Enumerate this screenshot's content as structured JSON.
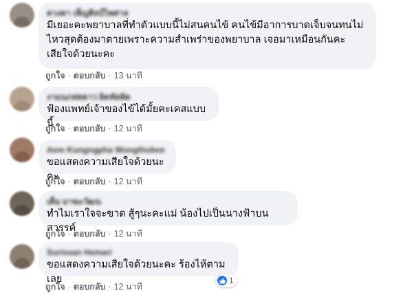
{
  "colors": {
    "bubble_bg": "#f0f2f5",
    "meta_text": "#65676b",
    "like_blue": "#1877f2"
  },
  "comments": [
    {
      "author": "ดวงตา เพ็ญศิลป์ไพศาล",
      "text": "มีเยอะคะพยาบาลที่ทำตัวแบบนี้ไม่สนคนไข้ คนไข้มีอาการบาดเจ็บจนทนไม่ไหวสุดต้องมาตายเพราะความสำเพร่าของพยาบาล เจอมาเหมือนกันคะ เสียใจด้วยนะคะ",
      "like": "ถูกใจ",
      "reply": "ตอบกลับ",
      "time": "13 นาที",
      "avatar_color": "#9a8f86"
    },
    {
      "author": "งามนภสตดาว ผิดหัดฝัด",
      "text": "ฟ้องแพทย์เจ้าของไข้ได้มั้ยคะเคสแบบนี้",
      "like": "ถูกใจ",
      "reply": "ตอบกลับ",
      "time": "12 นาที",
      "avatar_color": "#b8a48e"
    },
    {
      "author": "Aem Kungngpha Wongthubee",
      "text": "ขอแสดงความเสียใจด้วยนะคะ",
      "like": "ถูกใจ",
      "reply": "ตอบกลับ",
      "time": "12 นาที",
      "avatar_color": "#a07a67"
    },
    {
      "author": "เต็ม มาฆะวัฒน",
      "text": "ทำไมเราใจจะขาด สู้ๆนะคะแม่ น้องไปเป็นนางฟ้าบนสวรรค์",
      "like": "ถูกใจ",
      "reply": "ตอบกลับ",
      "time": "12 นาที",
      "avatar_color": "#6f6458"
    },
    {
      "author": "Surissan Hemari",
      "text": "ขอแสดงความเสียใจด้วยนะคะ ร้องไห้ตามเลย",
      "like": "ถูกใจ",
      "reply": "ตอบกลับ",
      "time": "12 นาที",
      "avatar_color": "#8d7f72",
      "reaction_count": "1"
    }
  ]
}
